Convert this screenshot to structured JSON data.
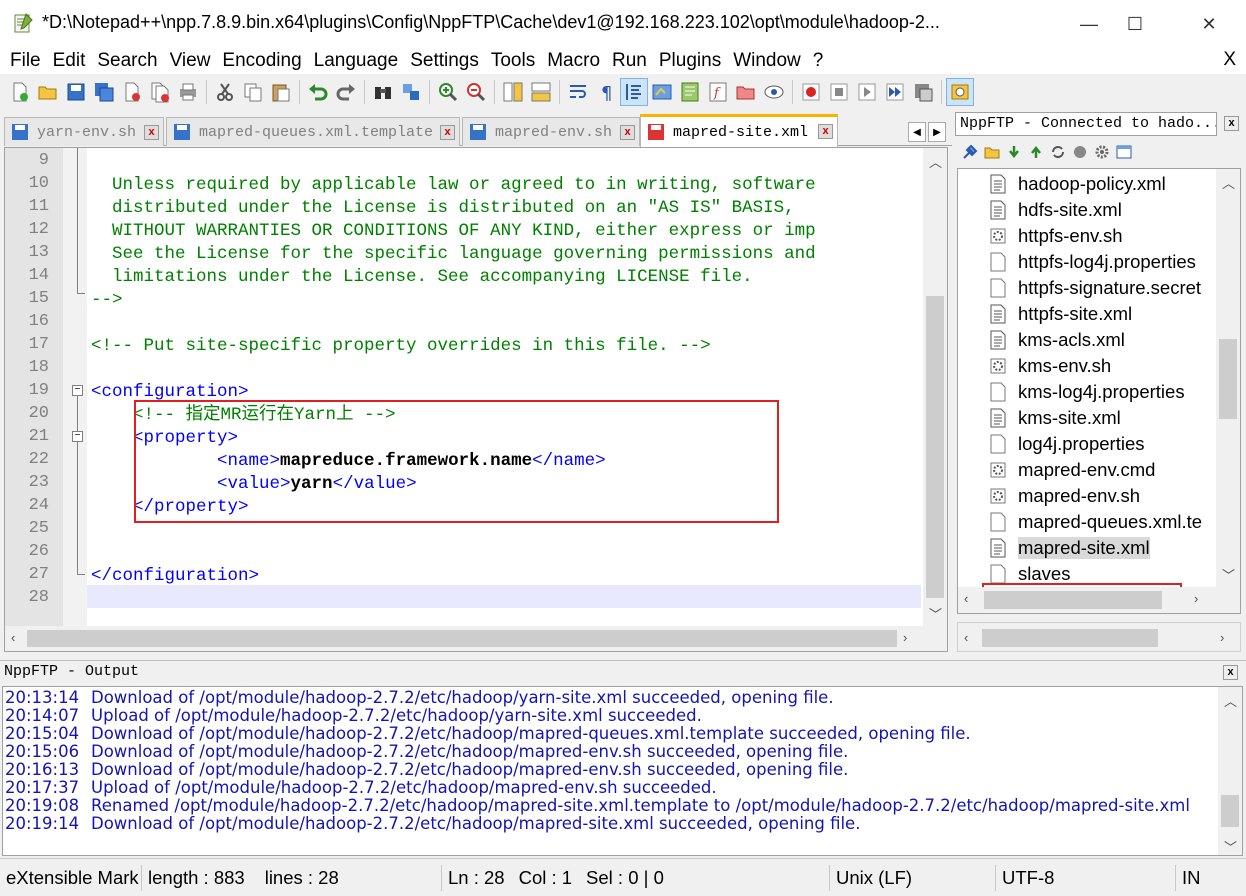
{
  "window": {
    "title": "*D:\\Notepad++\\npp.7.8.9.bin.x64\\plugins\\Config\\NppFTP\\Cache\\dev1@192.168.223.102\\opt\\module\\hadoop-2...",
    "minimize": "—",
    "maximize": "☐",
    "close": "✕"
  },
  "menu": {
    "items": [
      "File",
      "Edit",
      "Search",
      "View",
      "Encoding",
      "Language",
      "Settings",
      "Tools",
      "Macro",
      "Run",
      "Plugins",
      "Window",
      "?"
    ],
    "close": "X"
  },
  "tabs": [
    {
      "label": "yarn-env.sh",
      "icon": "save-icon-blue",
      "active": false
    },
    {
      "label": "mapred-queues.xml.template",
      "icon": "save-icon-blue",
      "active": false
    },
    {
      "label": "mapred-env.sh",
      "icon": "save-icon-blue",
      "active": false
    },
    {
      "label": "mapred-site.xml",
      "icon": "save-icon-red",
      "active": true
    }
  ],
  "editor": {
    "line_numbers": [
      "9",
      "10",
      "11",
      "12",
      "13",
      "14",
      "15",
      "16",
      "17",
      "18",
      "19",
      "20",
      "21",
      "22",
      "23",
      "24",
      "25",
      "26",
      "27",
      "28"
    ],
    "lines": {
      "l10": "  Unless required by applicable law or agreed to in writing, software",
      "l11": "  distributed under the License is distributed on an \"AS IS\" BASIS,",
      "l12": "  WITHOUT WARRANTIES OR CONDITIONS OF ANY KIND, either express or imp",
      "l13": "  See the License for the specific language governing permissions and",
      "l14": "  limitations under the License. See accompanying LICENSE file.",
      "l15": "-->",
      "l17": "<!-- Put site-specific property overrides in this file. -->",
      "l19": "<configuration>",
      "l20": "    <!-- 指定MR运行在Yarn上 -->",
      "l21_open": "    <property>",
      "l22_indent": "            ",
      "l22_open": "<name>",
      "l22_value": "mapreduce.framework.name",
      "l22_close": "</name>",
      "l23_indent": "            ",
      "l23_open": "<value>",
      "l23_value": "yarn",
      "l23_close": "</value>",
      "l24": "    </property>",
      "l27": "</configuration>"
    }
  },
  "ftp": {
    "title": "NppFTP - Connected to hado...",
    "close": "x",
    "files": [
      {
        "name": "hadoop-policy.xml",
        "icon": "xml-doc-icon"
      },
      {
        "name": "hdfs-site.xml",
        "icon": "xml-doc-icon"
      },
      {
        "name": "httpfs-env.sh",
        "icon": "script-icon"
      },
      {
        "name": "httpfs-log4j.properties",
        "icon": "blank-doc-icon"
      },
      {
        "name": "httpfs-signature.secret",
        "icon": "blank-doc-icon"
      },
      {
        "name": "httpfs-site.xml",
        "icon": "xml-doc-icon"
      },
      {
        "name": "kms-acls.xml",
        "icon": "xml-doc-icon"
      },
      {
        "name": "kms-env.sh",
        "icon": "script-icon"
      },
      {
        "name": "kms-log4j.properties",
        "icon": "blank-doc-icon"
      },
      {
        "name": "kms-site.xml",
        "icon": "xml-doc-icon"
      },
      {
        "name": "log4j.properties",
        "icon": "blank-doc-icon"
      },
      {
        "name": "mapred-env.cmd",
        "icon": "script-icon"
      },
      {
        "name": "mapred-env.sh",
        "icon": "script-icon"
      },
      {
        "name": "mapred-queues.xml.te",
        "icon": "blank-doc-icon"
      },
      {
        "name": "mapred-site.xml",
        "icon": "xml-doc-icon",
        "selected": true
      },
      {
        "name": "slaves",
        "icon": "blank-doc-icon"
      }
    ]
  },
  "output": {
    "title": "NppFTP - Output",
    "close": "x",
    "lines": [
      {
        "time": "20:13:14",
        "msg": "Download of /opt/module/hadoop-2.7.2/etc/hadoop/yarn-site.xml succeeded, opening file."
      },
      {
        "time": "20:14:07",
        "msg": "Upload of /opt/module/hadoop-2.7.2/etc/hadoop/yarn-site.xml succeeded."
      },
      {
        "time": "20:15:04",
        "msg": "Download of /opt/module/hadoop-2.7.2/etc/hadoop/mapred-queues.xml.template succeeded, opening file."
      },
      {
        "time": "20:15:06",
        "msg": "Download of /opt/module/hadoop-2.7.2/etc/hadoop/mapred-env.sh succeeded, opening file."
      },
      {
        "time": "20:16:13",
        "msg": "Download of /opt/module/hadoop-2.7.2/etc/hadoop/mapred-env.sh succeeded, opening file."
      },
      {
        "time": "20:17:37",
        "msg": "Upload of /opt/module/hadoop-2.7.2/etc/hadoop/mapred-env.sh succeeded."
      },
      {
        "time": "20:19:08",
        "msg": "Renamed /opt/module/hadoop-2.7.2/etc/hadoop/mapred-site.xml.template to /opt/module/hadoop-2.7.2/etc/hadoop/mapred-site.xml"
      },
      {
        "time": "20:19:14",
        "msg": "Download of /opt/module/hadoop-2.7.2/etc/hadoop/mapred-site.xml succeeded, opening file."
      }
    ]
  },
  "status": {
    "language": "eXtensible Mark",
    "length": "length : 883",
    "lines": "lines : 28",
    "ln": "Ln : 28",
    "col": "Col : 1",
    "sel": "Sel : 0 | 0",
    "eol": "Unix (LF)",
    "encoding": "UTF-8",
    "mode": "IN"
  },
  "colors": {
    "comment": "#008000",
    "tag": "#0000ff",
    "highlight_box": "#e02020",
    "log_text": "#1414b4"
  }
}
